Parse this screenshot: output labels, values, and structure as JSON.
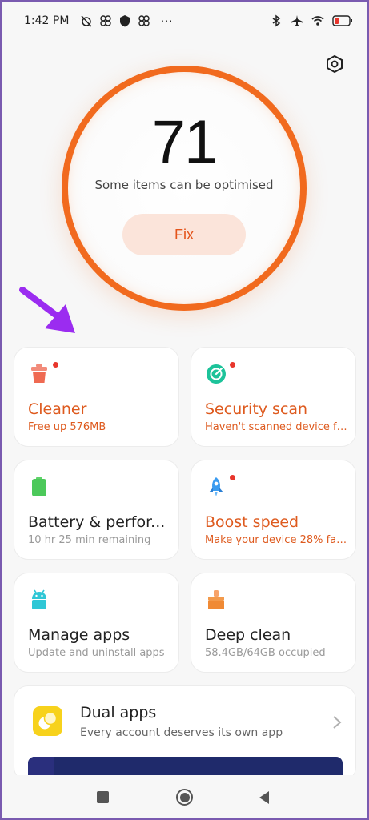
{
  "status_bar": {
    "time": "1:42 PM",
    "left_icons": [
      "no-alarm-icon",
      "pinwheel-icon",
      "shield-app-icon",
      "pinwheel-icon",
      "more-dots-icon"
    ],
    "right_icons": [
      "bluetooth-icon",
      "airplane-icon",
      "wifi-icon",
      "battery-icon"
    ],
    "overflow": "···"
  },
  "score": {
    "value": "71",
    "caption": "Some items can be optimised",
    "fix_label": "Fix"
  },
  "colors": {
    "accent": "#f16a1e",
    "alert_text": "#de5a1e",
    "annotation_arrow": "#9b2cf0",
    "dot": "#e8362c"
  },
  "cards": [
    {
      "title": "Cleaner",
      "subtitle": "Free up 576MB",
      "icon": "trash-icon",
      "alert": true
    },
    {
      "title": "Security scan",
      "subtitle": "Haven't scanned device fo...",
      "icon": "security-scan-icon",
      "alert": true
    },
    {
      "title": "Battery & perfor...",
      "subtitle": "10 hr 25 min  remaining",
      "icon": "battery-card-icon",
      "alert": false
    },
    {
      "title": "Boost speed",
      "subtitle": "Make your device 28% fas...",
      "icon": "rocket-icon",
      "alert": true
    },
    {
      "title": "Manage apps",
      "subtitle": "Update and uninstall apps",
      "icon": "android-icon",
      "alert": false
    },
    {
      "title": "Deep clean",
      "subtitle": "58.4GB/64GB occupied",
      "icon": "brush-icon",
      "alert": false
    }
  ],
  "dual_apps": {
    "title": "Dual apps",
    "subtitle": "Every account deserves its own app",
    "icon": "dual-apps-icon"
  },
  "nav": {
    "buttons": [
      "recents-button",
      "home-button",
      "back-button"
    ]
  }
}
